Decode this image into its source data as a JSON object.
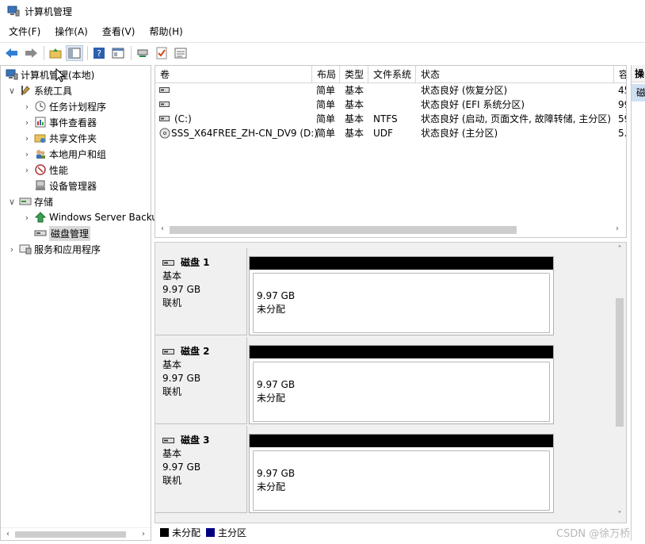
{
  "window": {
    "title": "计算机管理"
  },
  "menu": [
    "文件(F)",
    "操作(A)",
    "查看(V)",
    "帮助(H)"
  ],
  "toolbar": {
    "icons": [
      "back-arrow-icon",
      "forward-arrow-icon",
      "up-folder-icon",
      "show-hide-tree-icon",
      "help-icon",
      "properties-icon",
      "connect-icon",
      "check-icon",
      "list-view-icon"
    ]
  },
  "tree": {
    "root": "计算机管理(本地)",
    "system_tools": "系统工具",
    "task_scheduler": "任务计划程序",
    "event_viewer": "事件查看器",
    "shared_folders": "共享文件夹",
    "local_users": "本地用户和组",
    "performance": "性能",
    "device_manager": "设备管理器",
    "storage": "存储",
    "windows_backup": "Windows Server Backup",
    "disk_management": "磁盘管理",
    "services_apps": "服务和应用程序"
  },
  "volumes": {
    "columns": [
      "卷",
      "布局",
      "类型",
      "文件系统",
      "状态",
      "容"
    ],
    "rows": [
      {
        "name": "",
        "layout": "简单",
        "type": "基本",
        "fs": "",
        "status": "状态良好 (恢复分区)",
        "cap": "45"
      },
      {
        "name": "",
        "layout": "简单",
        "type": "基本",
        "fs": "",
        "status": "状态良好 (EFI 系统分区)",
        "cap": "99"
      },
      {
        "name": "(C:)",
        "layout": "简单",
        "type": "基本",
        "fs": "NTFS",
        "status": "状态良好 (启动, 页面文件, 故障转储, 主分区)",
        "cap": "59"
      },
      {
        "name": "SSS_X64FREE_ZH-CN_DV9 (D:)",
        "layout": "简单",
        "type": "基本",
        "fs": "UDF",
        "status": "状态良好 (主分区)",
        "cap": "5."
      }
    ]
  },
  "disks": [
    {
      "name": "磁盘 1",
      "type": "基本",
      "size": "9.97 GB",
      "state": "联机",
      "part_size": "9.97 GB",
      "part_state": "未分配"
    },
    {
      "name": "磁盘 2",
      "type": "基本",
      "size": "9.97 GB",
      "state": "联机",
      "part_size": "9.97 GB",
      "part_state": "未分配"
    },
    {
      "name": "磁盘 3",
      "type": "基本",
      "size": "9.97 GB",
      "state": "联机",
      "part_size": "9.97 GB",
      "part_state": "未分配"
    }
  ],
  "legend": [
    {
      "label": "未分配",
      "color": "#000000"
    },
    {
      "label": "主分区",
      "color": "#000080"
    }
  ],
  "actions": {
    "header": "操",
    "item": "磁"
  },
  "watermark": "CSDN @徐万桥",
  "colors": {
    "unallocated": "#000000",
    "primary": "#000080",
    "selection": "#d9d9d9"
  }
}
